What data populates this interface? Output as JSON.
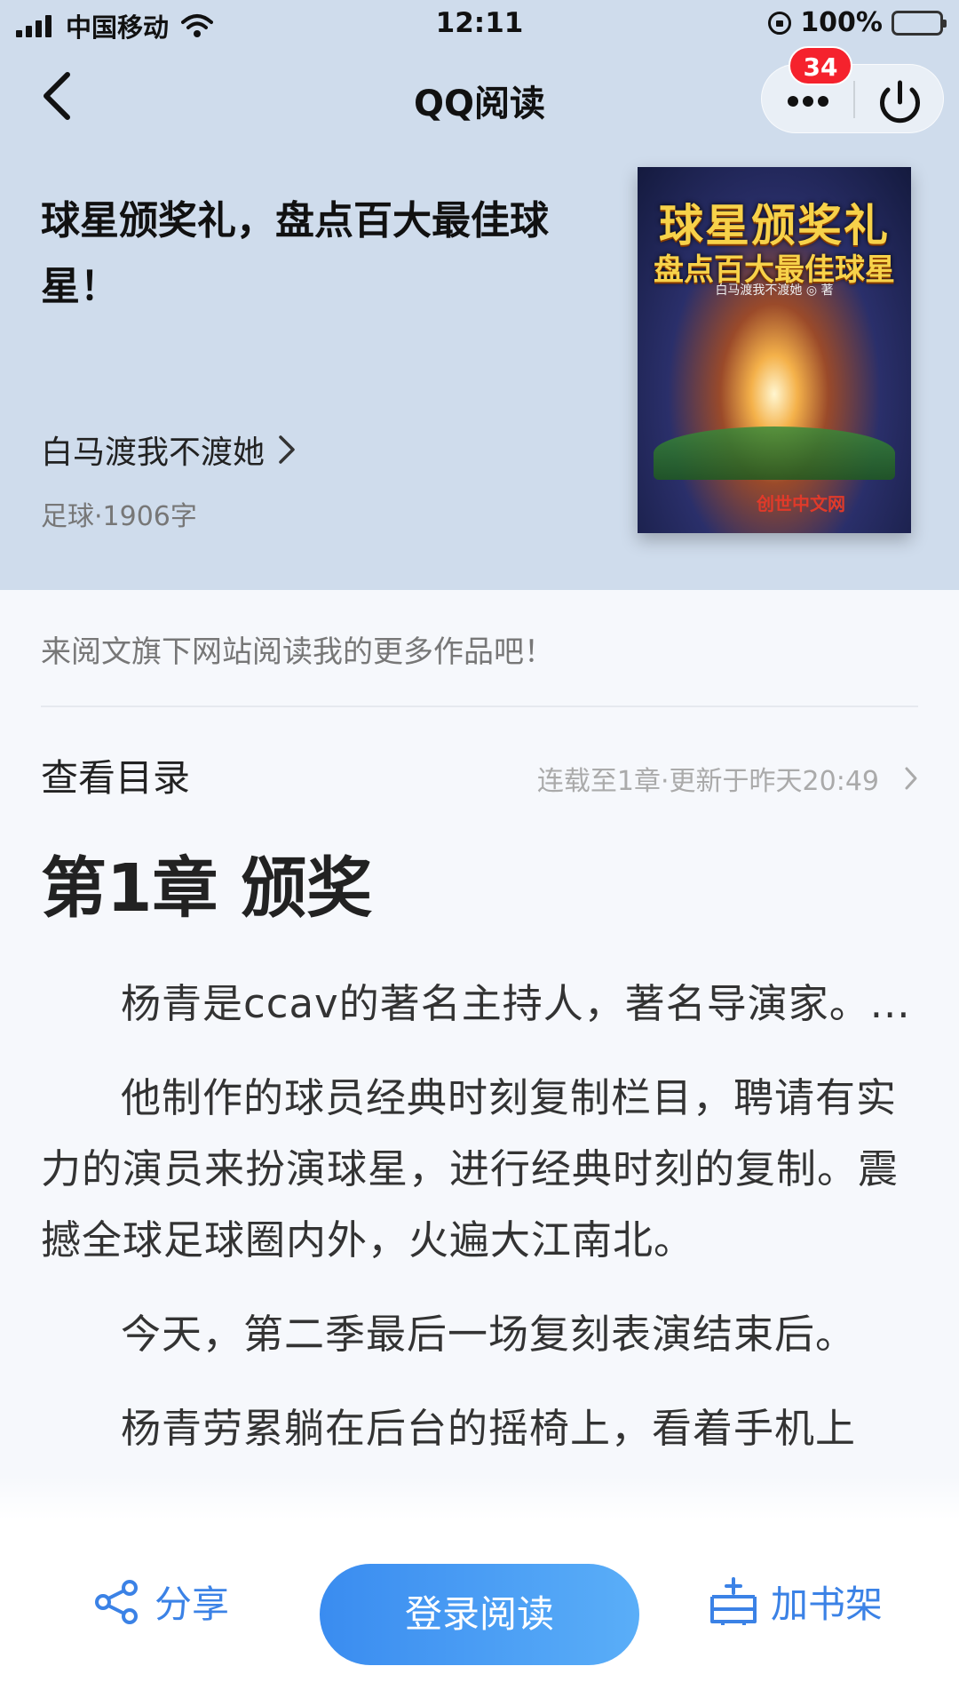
{
  "status_bar": {
    "carrier": "中国移动",
    "time": "12:11",
    "battery": "100%"
  },
  "nav": {
    "title": "QQ阅读",
    "badge_count": "34"
  },
  "book": {
    "title": "球星颁奖礼，盘点百大最佳球星！",
    "author": "白马渡我不渡她",
    "meta": "足球·1906字",
    "cover": {
      "title_line1": "球星颁奖礼",
      "title_line2": "盘点百大最佳球星",
      "author_line": "白马渡我不渡她 ◎ 著",
      "publisher": "创世中文网"
    }
  },
  "promo": "来阅文旗下网站阅读我的更多作品吧！",
  "toc": {
    "label": "查看目录",
    "status": "连载至1章·更新于昨天20:49"
  },
  "chapter": {
    "title": "第1章  颁奖",
    "paragraphs": [
      "杨青是ccav的著名主持人，著名导演家。...",
      "他制作的球员经典时刻复制栏目，聘请有实力的演员来扮演球星，进行经典时刻的复制。震撼全球足球圈内外，火遍大江南北。",
      "今天，第二季最后一场复刻表演结束后。",
      "杨青劳累躺在后台的摇椅上，看着手机上"
    ]
  },
  "bottom": {
    "share": "分享",
    "login": "登录阅读",
    "add_shelf": "加书架"
  },
  "colors": {
    "accent": "#3b82e6",
    "header_bg": "#cfdcec",
    "badge": "#f5222d"
  },
  "icons": [
    "back-icon",
    "more-icon",
    "power-icon",
    "chevron-right-icon",
    "share-icon",
    "bookshelf-add-icon"
  ]
}
